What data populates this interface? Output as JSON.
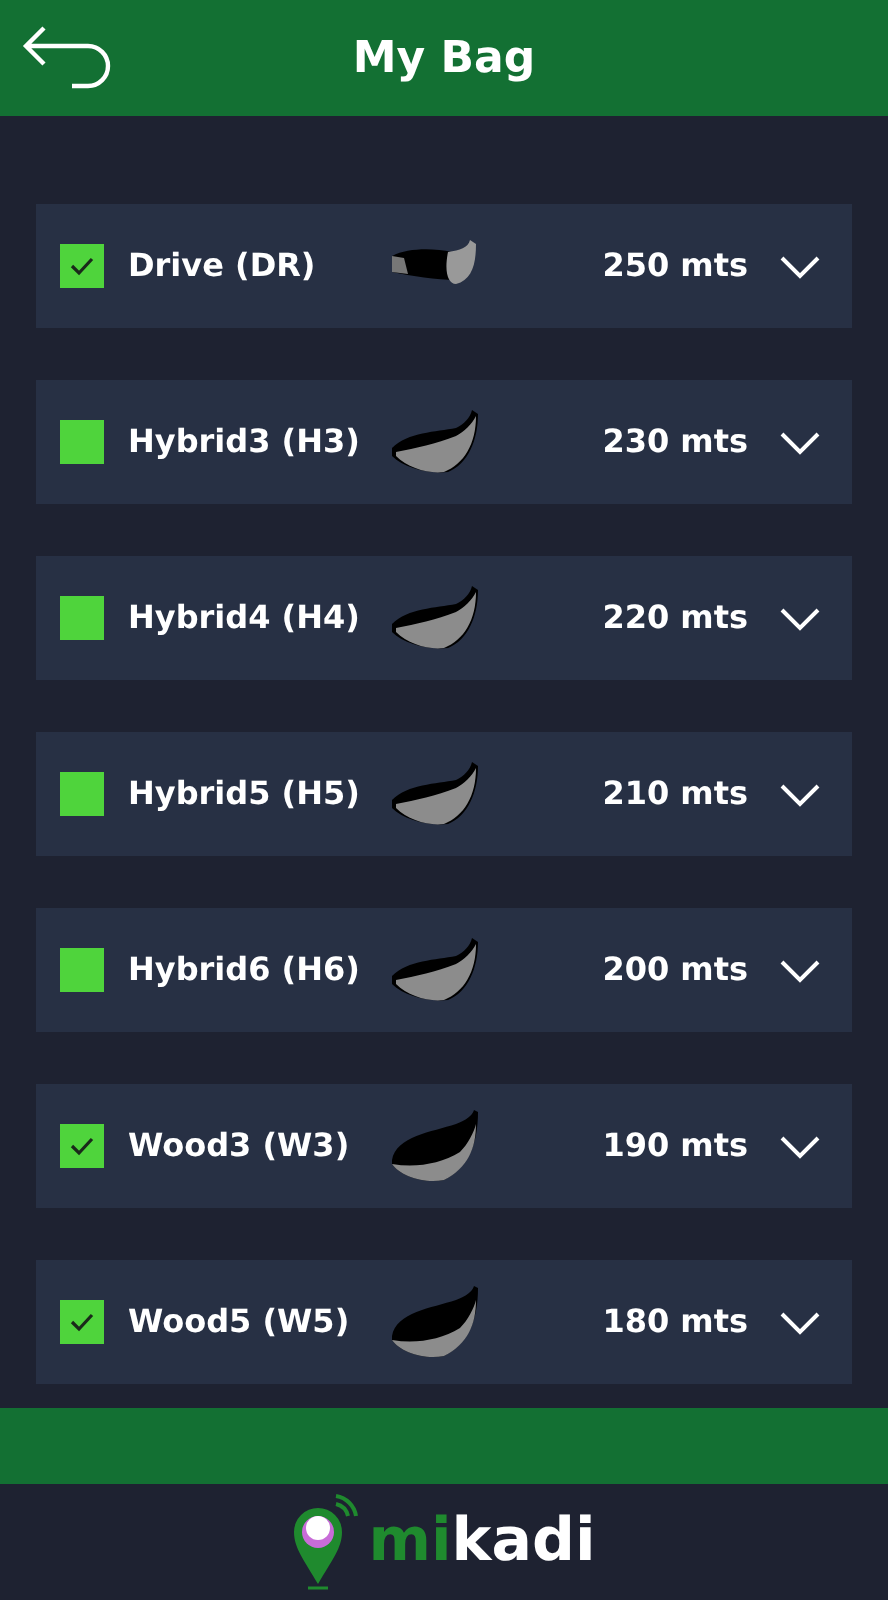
{
  "header": {
    "title": "My Bag"
  },
  "clubs": [
    {
      "name": "Drive (DR)",
      "kind": "driver",
      "checked": true,
      "distance": "250 mts"
    },
    {
      "name": "Hybrid3 (H3)",
      "kind": "hybrid",
      "checked": false,
      "distance": "230 mts"
    },
    {
      "name": "Hybrid4 (H4)",
      "kind": "hybrid",
      "checked": false,
      "distance": "220 mts"
    },
    {
      "name": "Hybrid5 (H5)",
      "kind": "hybrid",
      "checked": false,
      "distance": "210 mts"
    },
    {
      "name": "Hybrid6 (H6)",
      "kind": "hybrid",
      "checked": false,
      "distance": "200 mts"
    },
    {
      "name": "Wood3 (W3)",
      "kind": "wood",
      "checked": true,
      "distance": "190 mts"
    },
    {
      "name": "Wood5 (W5)",
      "kind": "wood",
      "checked": true,
      "distance": "180 mts"
    }
  ],
  "logo": {
    "part_1": "mi",
    "part_2": "kadi"
  }
}
